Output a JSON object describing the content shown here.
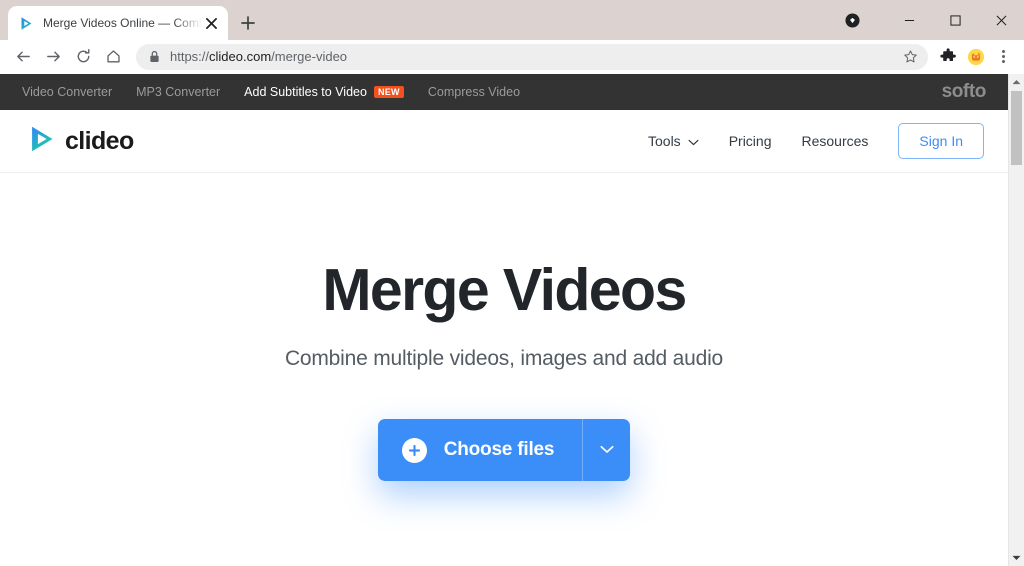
{
  "browser": {
    "tab": {
      "title": "Merge Videos Online — Combine Video Files for Free",
      "favicon_icon": "clideo-play-icon",
      "close_icon": "close-icon"
    },
    "new_tab_icon": "plus-icon",
    "window_controls": {
      "profile_icon": "profile-avatar-icon",
      "minimize_icon": "minimize-icon",
      "maximize_icon": "maximize-icon",
      "close_icon": "window-close-icon"
    },
    "toolbar": {
      "back_icon": "back-arrow-icon",
      "forward_icon": "forward-arrow-icon",
      "reload_icon": "reload-icon",
      "home_icon": "home-icon",
      "lock_icon": "lock-icon",
      "url_prefix": "https://",
      "url_domain": "clideo.com",
      "url_path": "/merge-video",
      "url_full": "https://clideo.com/merge-video",
      "bookmark_icon": "star-icon",
      "extensions_icon": "puzzle-piece-icon",
      "extension_2_icon": "dog-extension-icon",
      "menu_icon": "three-dot-menu-icon"
    },
    "scrollbar": {
      "up_arrow_icon": "scroll-up-arrow-icon",
      "down_arrow_icon": "scroll-down-arrow-icon"
    }
  },
  "page": {
    "topbar": {
      "links": [
        {
          "label": "Video Converter",
          "active": false
        },
        {
          "label": "MP3 Converter",
          "active": false
        },
        {
          "label": "Add Subtitles to Video",
          "active": true,
          "badge": "NEW"
        },
        {
          "label": "Compress Video",
          "active": false
        }
      ],
      "brand": "softo"
    },
    "header": {
      "logo_icon": "clideo-play-logo-icon",
      "logo_text": "clideo",
      "nav": [
        {
          "label": "Tools",
          "icon": "chevron-down-icon"
        },
        {
          "label": "Pricing",
          "icon": ""
        },
        {
          "label": "Resources",
          "icon": ""
        }
      ],
      "sign_in_label": "Sign In"
    },
    "hero": {
      "title": "Merge Videos",
      "subtitle": "Combine multiple videos, images and add audio",
      "cta": {
        "plus_icon": "plus-circle-icon",
        "label": "Choose files",
        "dropdown_icon": "chevron-down-icon"
      }
    }
  },
  "colors": {
    "accent_blue": "#3b8ef8",
    "topbar_dark": "#333333",
    "badge_orange": "#f4511e",
    "tabstrip": "#dcd3d0"
  }
}
